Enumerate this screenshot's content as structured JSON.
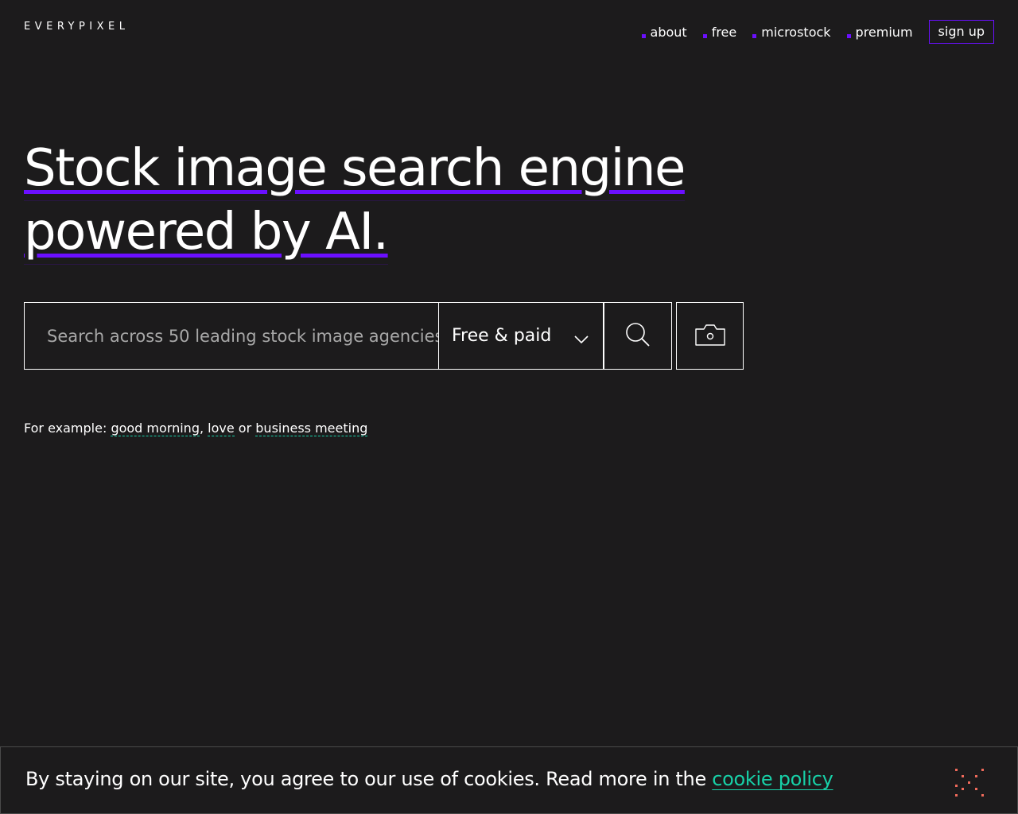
{
  "header": {
    "logo_text": "EVERYPIXEL",
    "nav": [
      {
        "label": "about"
      },
      {
        "label": "free"
      },
      {
        "label": "microstock"
      },
      {
        "label": "premium"
      }
    ],
    "signup_label": "sign up"
  },
  "hero": {
    "line1": "Stock image search engine",
    "line2": "powered by AI."
  },
  "search": {
    "placeholder": "Search across 50 leading stock image agencies",
    "value": "",
    "filter_selected": "Free & paid"
  },
  "examples": {
    "prefix": "For example:",
    "items": [
      "good morning",
      "love",
      "business meeting"
    ],
    "sep1": ",",
    "sep2": "or"
  },
  "cookie": {
    "text": "By staying on our site, you agree to our use of cookies. Read more in the",
    "link_label": "cookie policy"
  },
  "colors": {
    "background": "#1c1b1c",
    "accent_purple": "#6b0fff",
    "link_teal": "#17d1a8",
    "close_coral": "#f06a5b"
  },
  "icons": {
    "search": "magnifier-icon",
    "camera": "camera-icon",
    "chevron": "chevron-down-icon",
    "close": "close-icon"
  }
}
